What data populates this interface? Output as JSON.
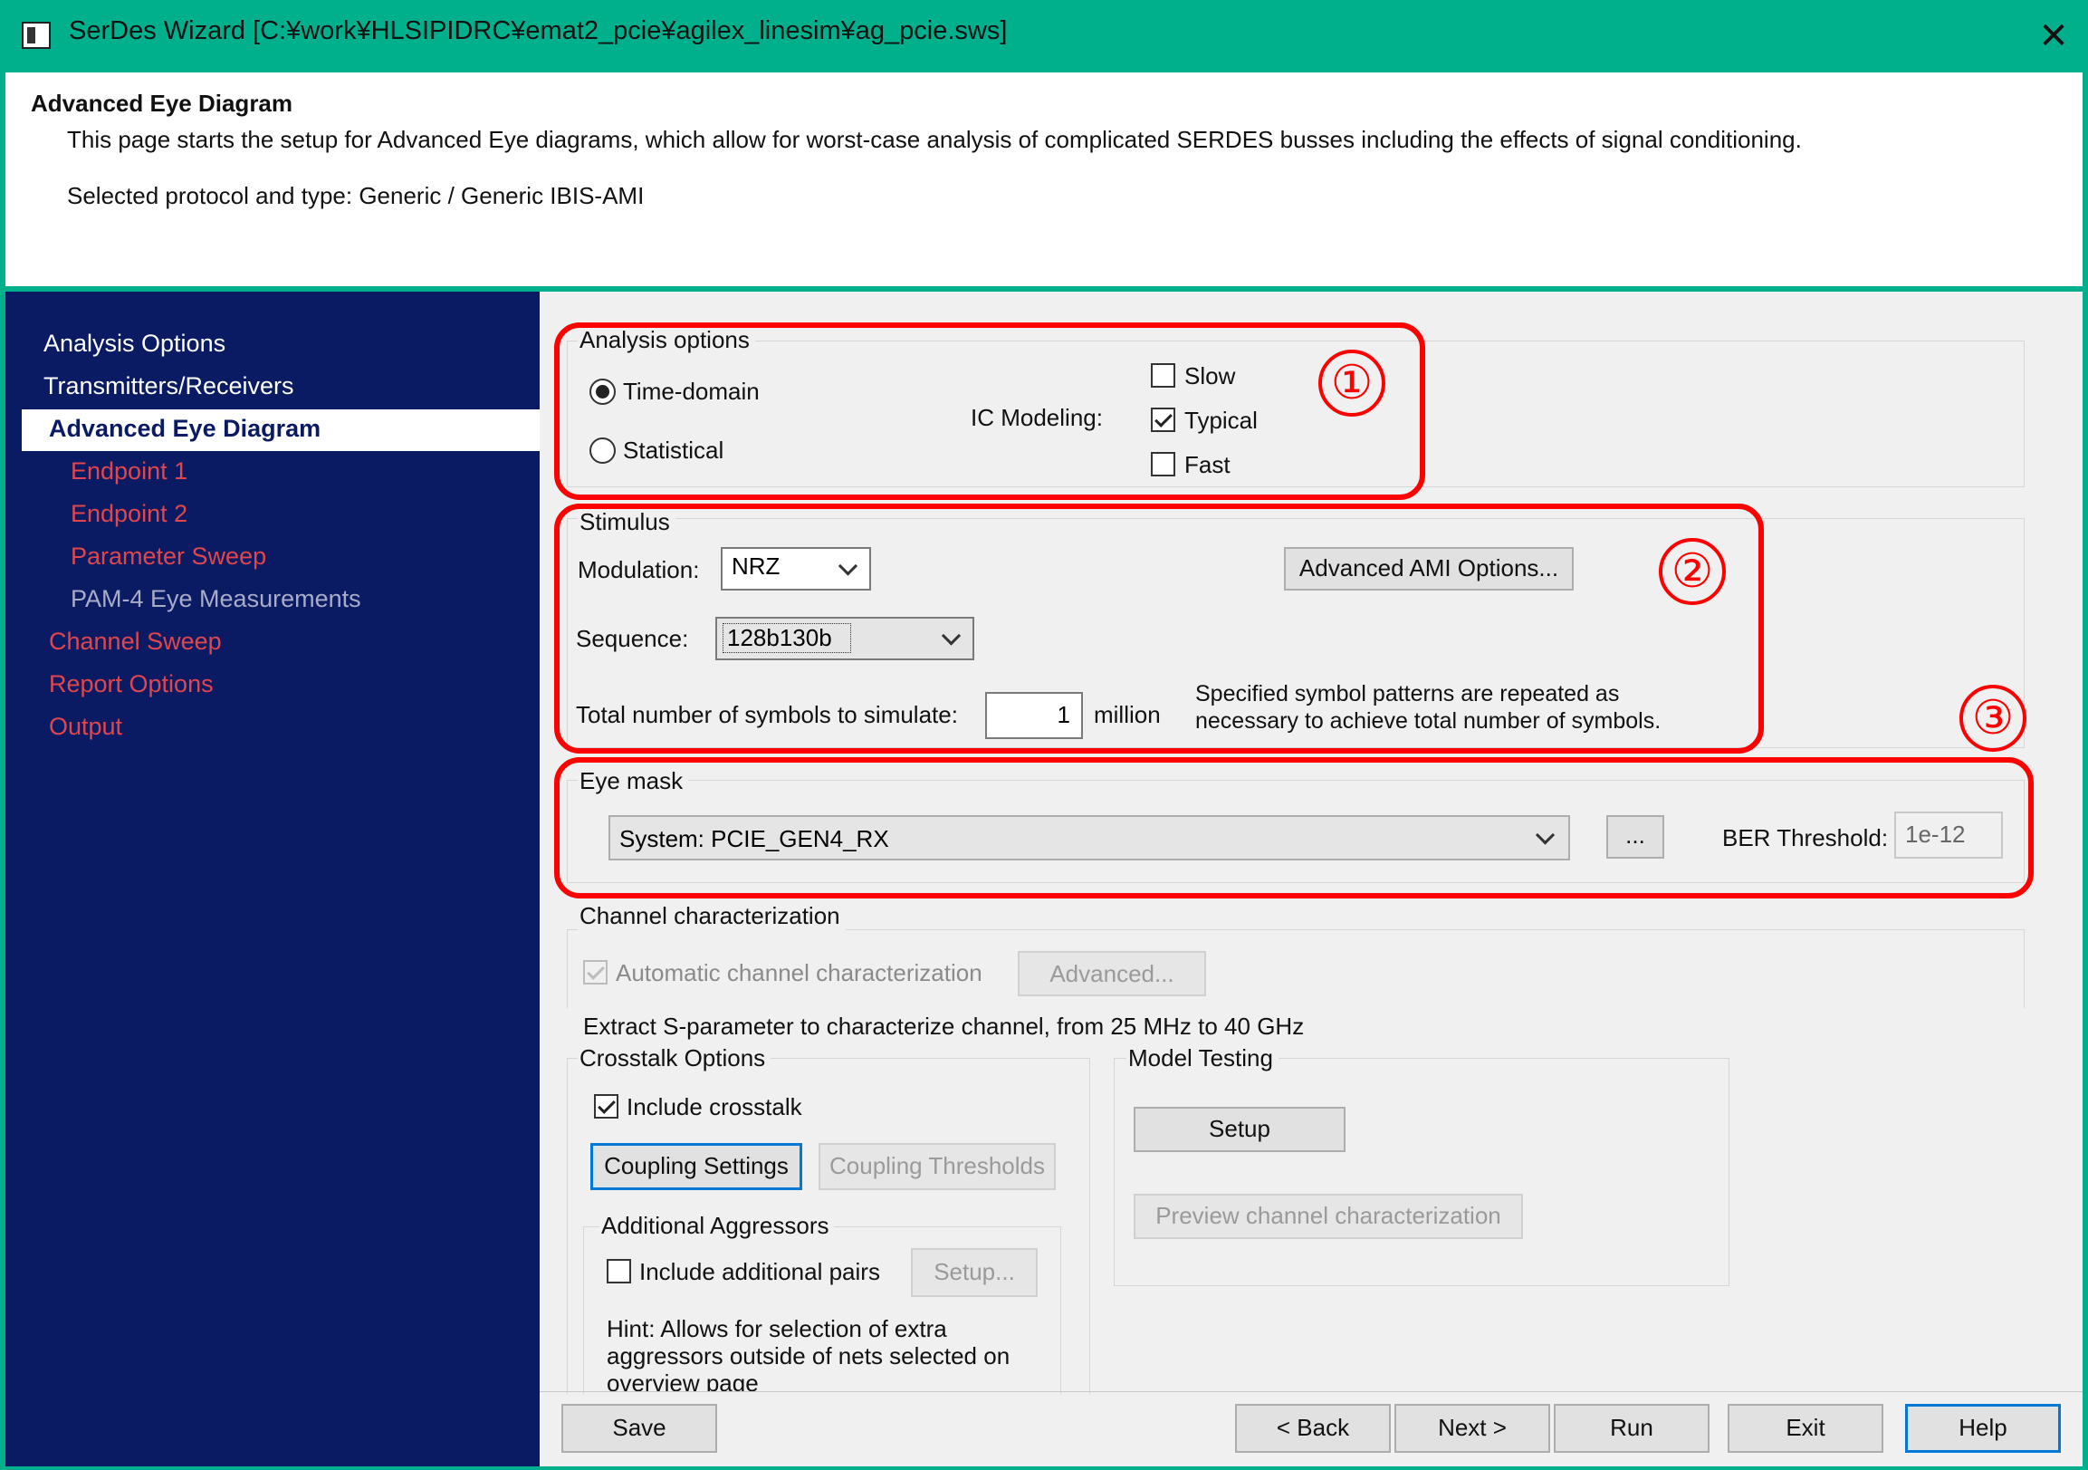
{
  "window": {
    "title": "SerDes Wizard [C:¥work¥HLSIPIDRC¥emat2_pcie¥agilex_linesim¥ag_pcie.sws]",
    "close_glyph": "✕"
  },
  "header": {
    "title": "Advanced Eye Diagram",
    "description": "This page starts the setup for Advanced Eye diagrams, which allow for worst-case analysis of complicated SERDES busses including the effects of signal conditioning.",
    "protocol_line": "Selected protocol and type: Generic / Generic IBIS-AMI"
  },
  "sidebar": {
    "items": [
      {
        "label": "Analysis Options"
      },
      {
        "label": "Transmitters/Receivers"
      },
      {
        "label": "Advanced Eye Diagram"
      },
      {
        "label": "Endpoint 1"
      },
      {
        "label": "Endpoint 2"
      },
      {
        "label": "Parameter Sweep"
      },
      {
        "label": "PAM-4 Eye Measurements"
      },
      {
        "label": "Channel Sweep"
      },
      {
        "label": "Report Options"
      },
      {
        "label": "Output"
      }
    ]
  },
  "analysis": {
    "group_title": "Analysis options",
    "time_domain": "Time-domain",
    "statistical": "Statistical",
    "ic_label": "IC Modeling:",
    "slow": "Slow",
    "typical": "Typical",
    "fast": "Fast"
  },
  "stimulus": {
    "group_title": "Stimulus",
    "modulation_label": "Modulation:",
    "modulation_value": "NRZ",
    "ami_button": "Advanced AMI Options...",
    "sequence_label": "Sequence:",
    "sequence_value": "128b130b",
    "symbols_label": "Total number of symbols to simulate:",
    "symbols_value": "1",
    "symbols_unit": "million",
    "note_line1": "Specified symbol patterns are repeated as",
    "note_line2": "necessary to achieve total number of symbols."
  },
  "eye_mask": {
    "group_title": "Eye mask",
    "mask_value": "System: PCIE_GEN4_RX",
    "browse_button": "...",
    "ber_label": "BER Threshold:",
    "ber_value": "1e-12"
  },
  "channel": {
    "group_title": "Channel characterization",
    "auto_label": "Automatic channel characterization",
    "advanced_button": "Advanced...",
    "extract_text": "Extract S-parameter to characterize channel, from 25 MHz to 40 GHz"
  },
  "crosstalk": {
    "group_title": "Crosstalk Options",
    "include_label": "Include crosstalk",
    "coupling_settings": "Coupling Settings",
    "coupling_thresholds": "Coupling Thresholds",
    "aggressors_title": "Additional Aggressors",
    "pairs_label": "Include additional pairs",
    "setup_button": "Setup...",
    "hint_line1": "Hint: Allows for selection of extra",
    "hint_line2": "aggressors outside of nets selected on",
    "hint_line3": "overview page"
  },
  "model_testing": {
    "group_title": "Model Testing",
    "setup_button": "Setup",
    "preview_button": "Preview channel characterization"
  },
  "footer": {
    "save": "Save",
    "back": "< Back",
    "next": "Next >",
    "run": "Run",
    "exit": "Exit",
    "help": "Help"
  },
  "annotations": {
    "one": "①",
    "two": "②",
    "three": "③",
    "color": "#ff0000"
  },
  "colors": {
    "titlebar": "#00b08c",
    "sidebar": "#0a1a63",
    "nav_link": "#e0474c",
    "focus": "#0078d7"
  }
}
